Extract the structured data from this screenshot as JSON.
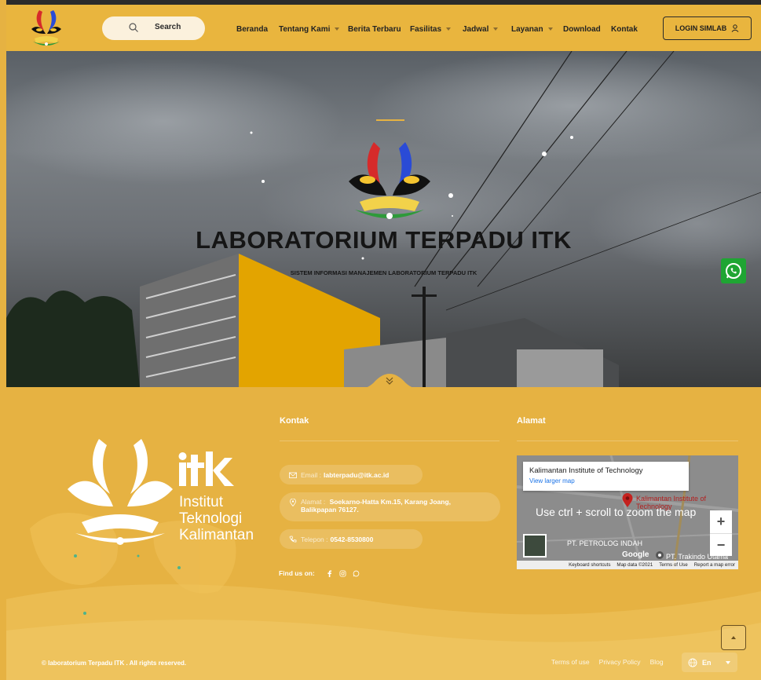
{
  "header": {
    "search_label": "Search",
    "nav": [
      {
        "label": "Beranda",
        "dropdown": false
      },
      {
        "label": "Tentang Kami",
        "dropdown": true
      },
      {
        "label": "Berita Terbaru",
        "dropdown": false
      },
      {
        "label": "Fasilitas",
        "dropdown": true
      },
      {
        "label": "Jadwal",
        "dropdown": true
      },
      {
        "label": "Layanan",
        "dropdown": true
      },
      {
        "label": "Download",
        "dropdown": false
      },
      {
        "label": "Kontak",
        "dropdown": false
      }
    ],
    "login_label": "LOGIN SIMLAB"
  },
  "hero": {
    "title": "LABORATORIUM TERPADU ITK",
    "subtitle": "SISTEM INFORMASI MANAJEMEN LABORATORIUM TERPADU ITK"
  },
  "footer": {
    "logo_text": [
      "Institut",
      "Teknologi",
      "Kalimantan"
    ],
    "logo_mark": "itk",
    "contact": {
      "title": "Kontak",
      "email_label": "Email :",
      "email": "labterpadu@itk.ac.id",
      "address_label": "Alamat :",
      "address": "Soekarno-Hatta Km.15, Karang Joang, Balikpapan 76127.",
      "phone_label": "Telepon :",
      "phone": "0542-8530800",
      "find_us": "Find us on:"
    },
    "address_col": {
      "title": "Alamat",
      "map": {
        "place_title": "Kalimantan Institute of Technology",
        "larger_map": "View larger map",
        "hint": "Use ctrl + scroll to zoom the map",
        "pin_label": "Kalimantan Institute of Technology",
        "place1": "PT. PETROLOG INDAH",
        "place2": "PT. Trakindo Utama",
        "brand": "Google",
        "credits": [
          "Keyboard shortcuts",
          "Map data ©2021",
          "Terms of Use",
          "Report a map error"
        ]
      }
    },
    "copyright": "© laboratorium Terpadu ITK . All rights reserved.",
    "links": [
      "Terms of use",
      "Privacy Policy",
      "Blog"
    ],
    "language": "En"
  },
  "colors": {
    "brand_yellow": "#e6b242",
    "header_yellow": "#e9b53e",
    "whatsapp_green": "#1fa533"
  }
}
